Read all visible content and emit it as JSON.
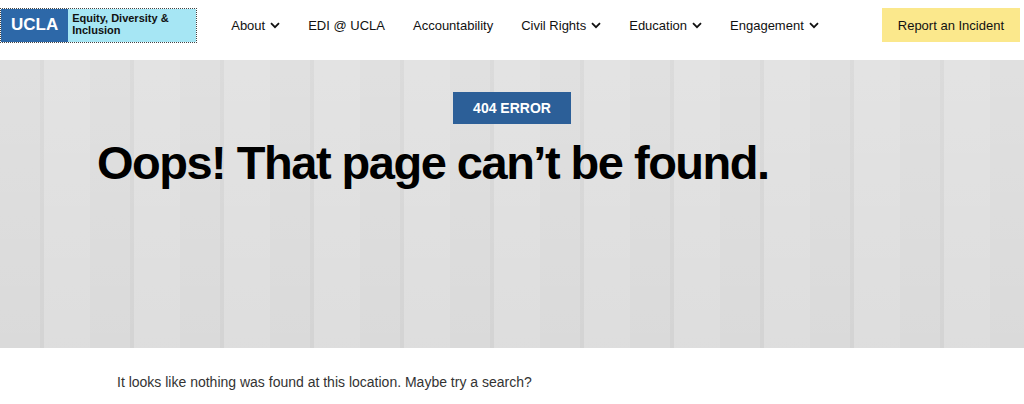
{
  "logo": {
    "mark": "UCLA",
    "name": "Equity, Diversity & Inclusion"
  },
  "nav": [
    {
      "label": "About",
      "has_dropdown": true
    },
    {
      "label": "EDI @ UCLA",
      "has_dropdown": false
    },
    {
      "label": "Accountability",
      "has_dropdown": false
    },
    {
      "label": "Civil Rights",
      "has_dropdown": true
    },
    {
      "label": "Education",
      "has_dropdown": true
    },
    {
      "label": "Engagement",
      "has_dropdown": true
    }
  ],
  "cta": "Report an Incident",
  "hero": {
    "badge": "404 ERROR",
    "title": "Oops! That page can’t be found."
  },
  "message": "It looks like nothing was found at this location. Maybe try a search?"
}
